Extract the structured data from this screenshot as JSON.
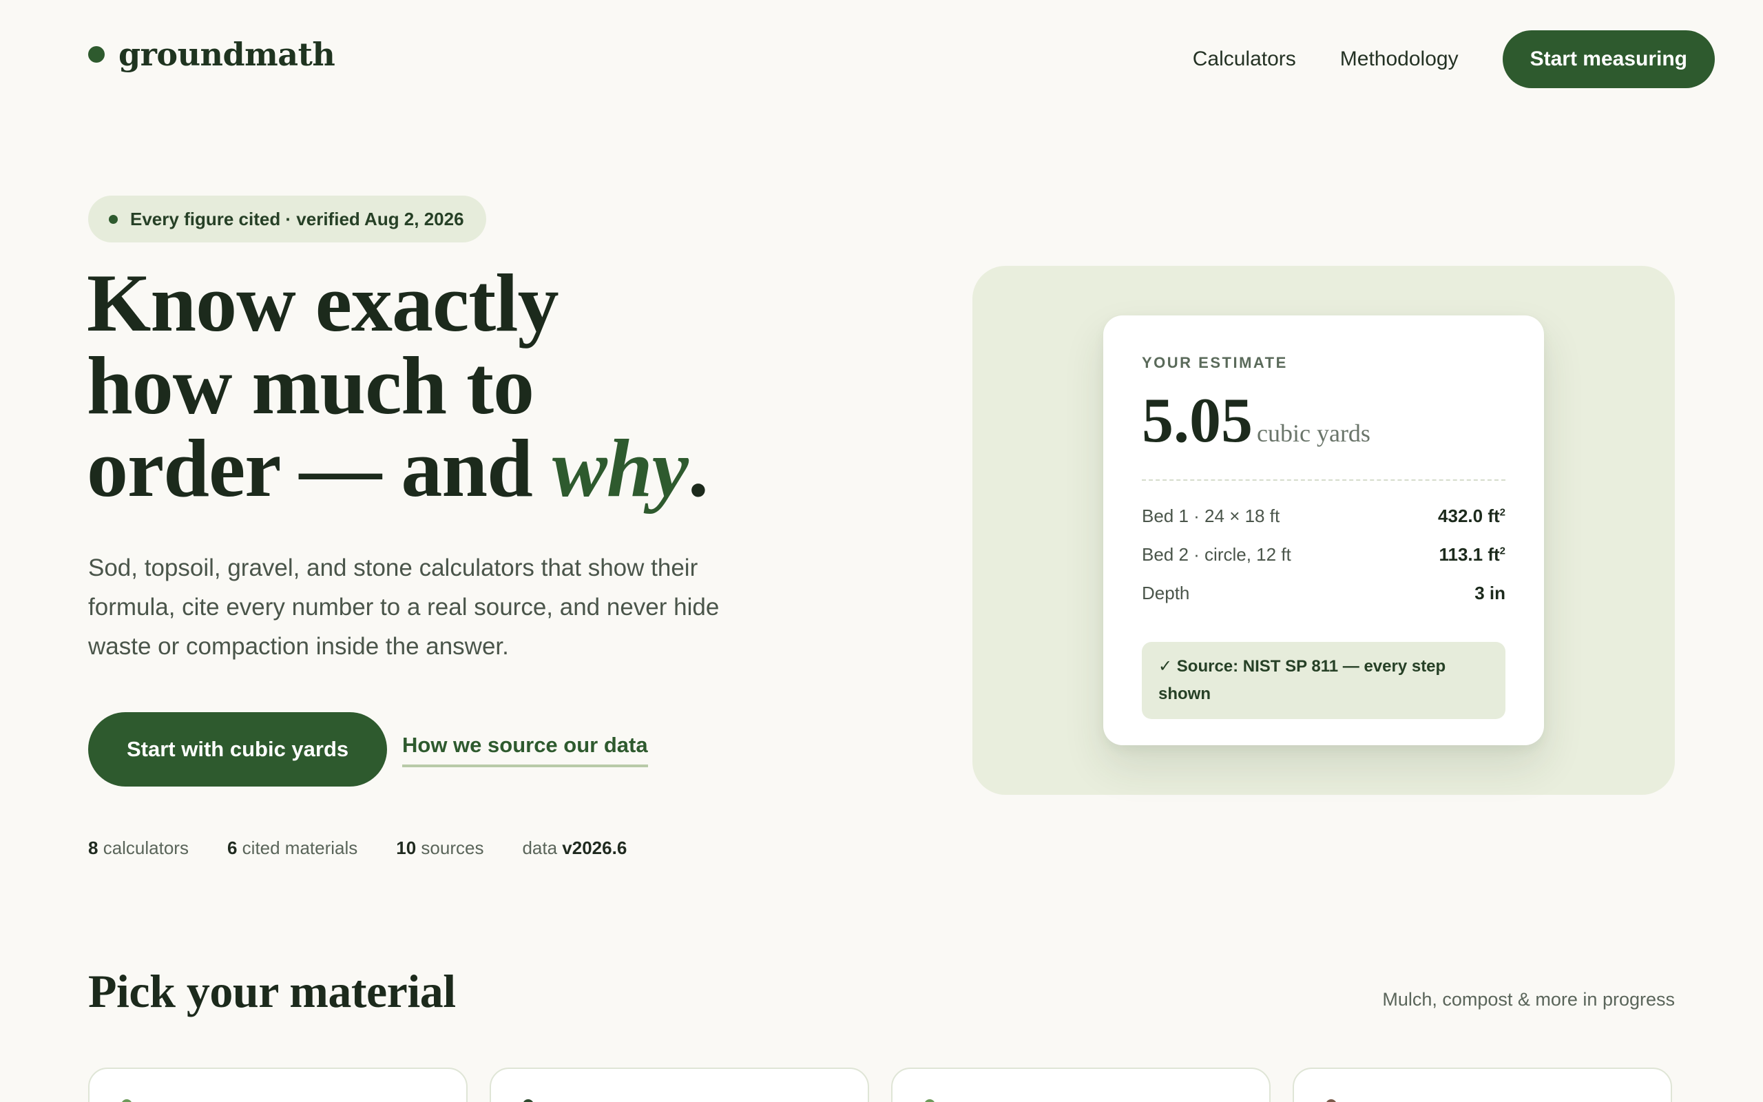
{
  "header": {
    "logo_text": "groundmath",
    "nav": [
      {
        "label": "Calculators"
      },
      {
        "label": "Methodology"
      }
    ],
    "cta_label": "Start measuring"
  },
  "hero": {
    "badge": "Every figure cited · verified Aug 2, 2026",
    "headline_line1": "Know exactly",
    "headline_line2": "how much to",
    "headline_line3_pre": "order — and ",
    "headline_line3_em": "why",
    "headline_line3_post": ".",
    "lede": "Sod, topsoil, gravel, and stone calculators that show their formula, cite every number to a real source, and never hide waste or compaction inside the answer.",
    "primary_cta": "Start with cubic yards",
    "secondary_cta": "How we source our data",
    "stats": [
      {
        "value": "8",
        "label": " calculators"
      },
      {
        "value": "6",
        "label": " cited materials"
      },
      {
        "value": "10",
        "label": " sources"
      },
      {
        "prefix": "data ",
        "value": "v2026.6"
      }
    ]
  },
  "estimate": {
    "label": "YOUR ESTIMATE",
    "value": "5.05",
    "unit": "cubic yards",
    "rows": [
      {
        "key": "Bed 1 · 24 × 18 ft",
        "value": "432.0 ft",
        "sup": "2"
      },
      {
        "key": "Bed 2 · circle, 12 ft",
        "value": "113.1 ft",
        "sup": "2"
      },
      {
        "key": "Depth",
        "value": "3 in",
        "sup": ""
      }
    ],
    "source": "✓ Source: NIST SP 811 — every step shown"
  },
  "section": {
    "title": "Pick your material",
    "note": "Mulch, compost & more in progress"
  },
  "cards": [
    {
      "dot_color": "#6d9a5a"
    },
    {
      "dot_color": "#2e4a2e"
    },
    {
      "dot_color": "#6d9a5a"
    },
    {
      "dot_color": "#7a5a4a"
    }
  ],
  "colors": {
    "accent": "#2e5a2e",
    "background": "#faf9f5",
    "panel": "#e9eedd"
  }
}
